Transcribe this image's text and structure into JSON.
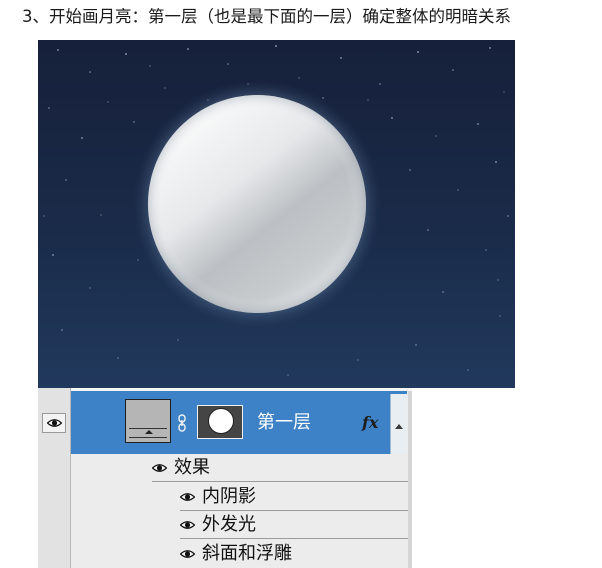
{
  "step_title": "3、开始画月亮：第一层（也是最下面的一层）确定整体的明暗关系",
  "layers_panel": {
    "layer": {
      "name": "第一层",
      "fx_label": "fx"
    },
    "effects_group": {
      "label": "效果"
    },
    "effects": [
      {
        "label": "内阴影"
      },
      {
        "label": "外发光"
      },
      {
        "label": "斜面和浮雕"
      }
    ]
  },
  "colors": {
    "selected_layer": "#3d82c6",
    "sky_top": "#16203a",
    "sky_bottom": "#1f3a5e"
  }
}
